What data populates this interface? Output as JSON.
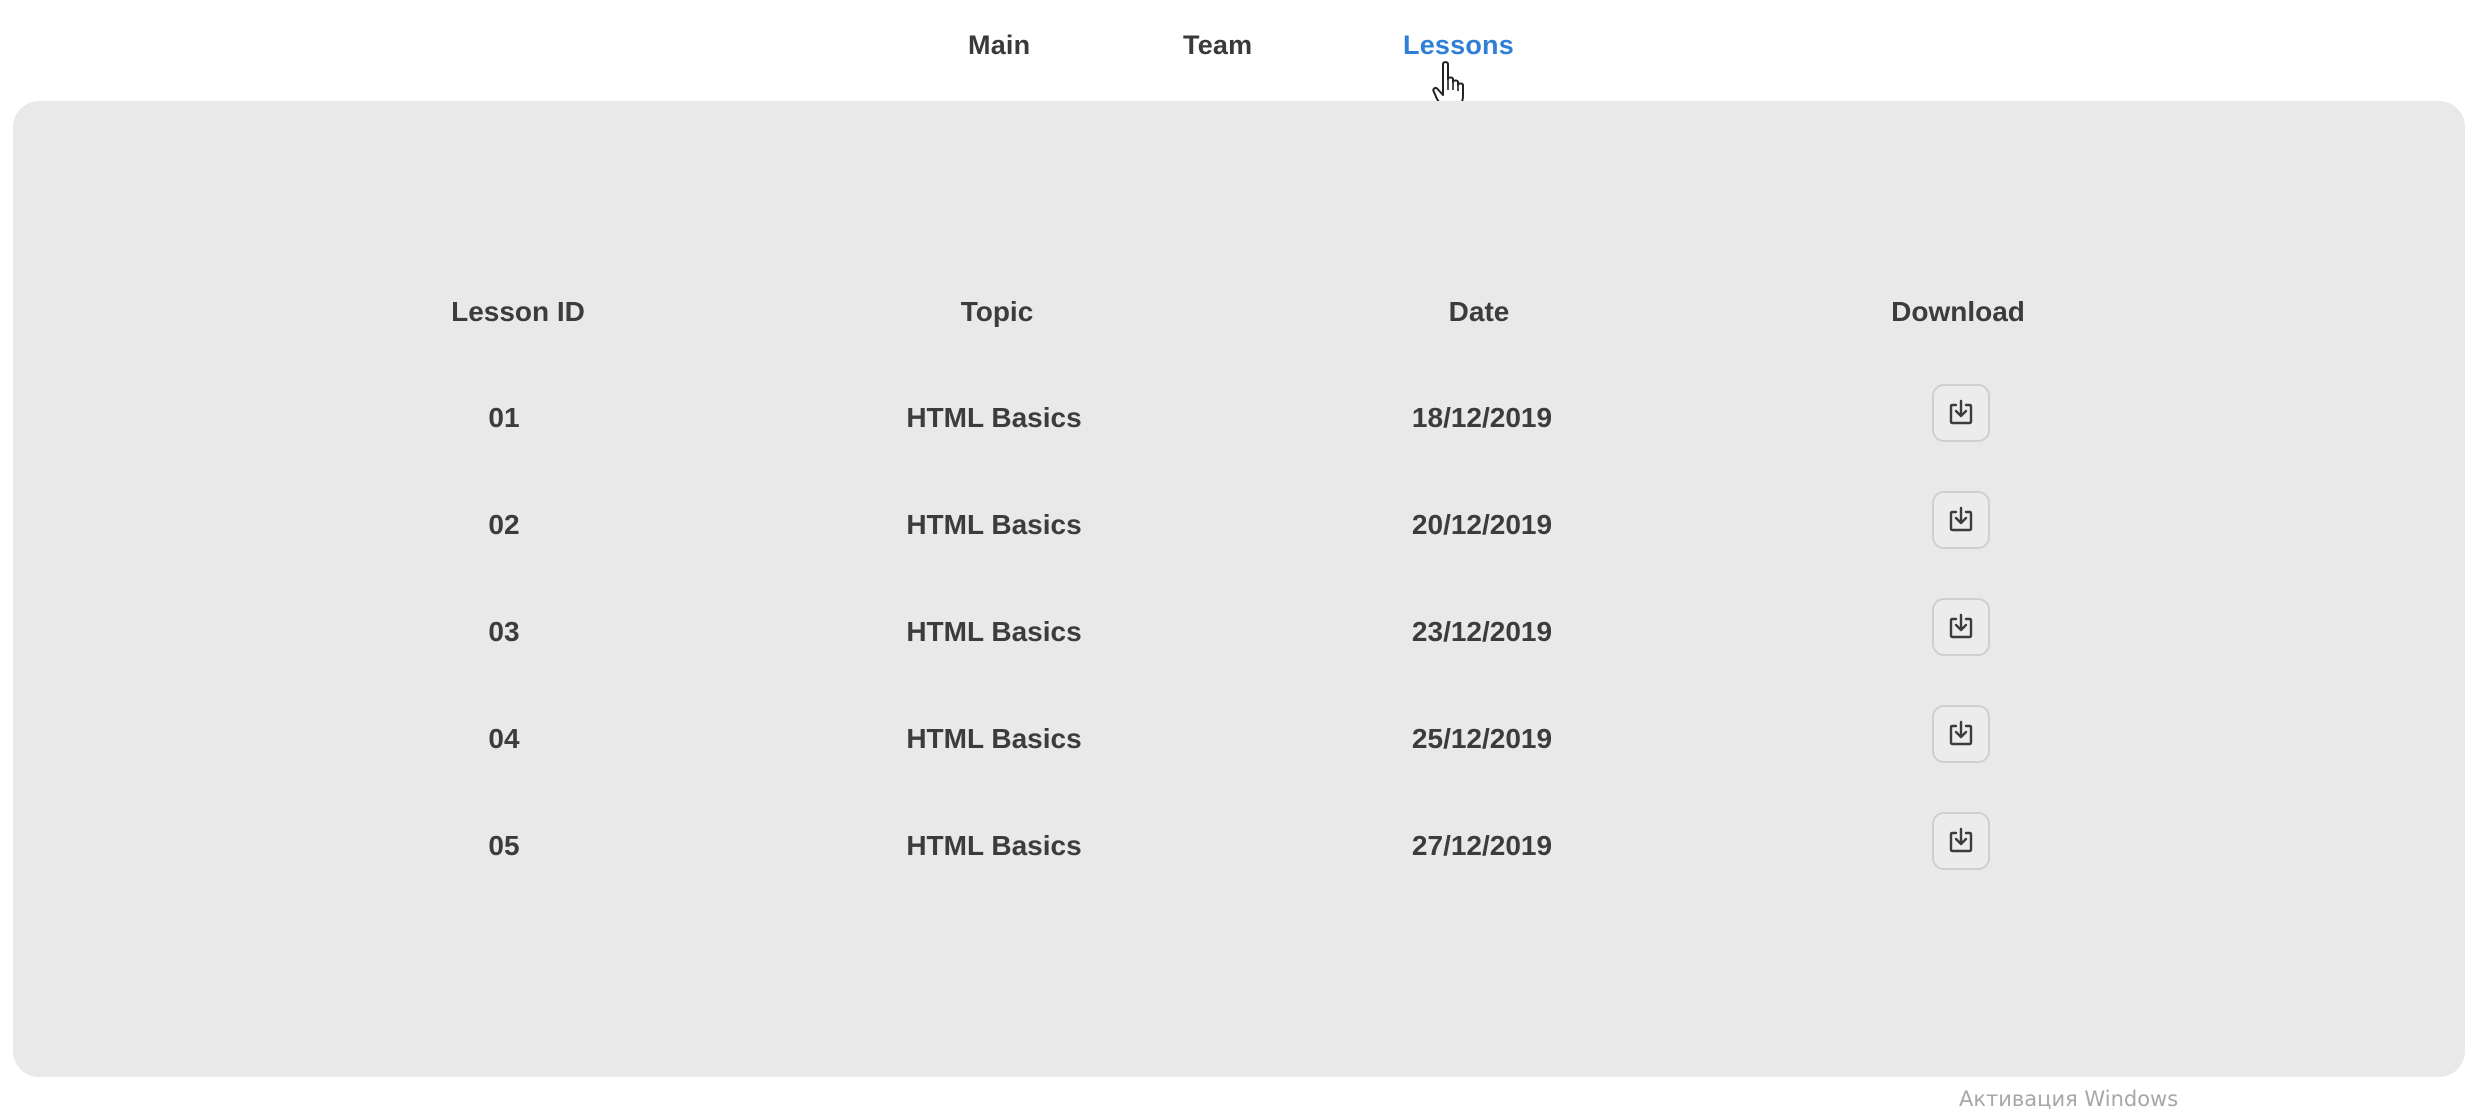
{
  "nav": {
    "items": [
      {
        "label": "Main",
        "active": false
      },
      {
        "label": "Team",
        "active": false
      },
      {
        "label": "Lessons",
        "active": true
      }
    ],
    "active_color": "#2f7fd7"
  },
  "table": {
    "columns": [
      "Lesson ID",
      "Topic",
      "Date",
      "Download"
    ],
    "rows": [
      {
        "id": "01",
        "topic": "HTML Basics",
        "date": "18/12/2019",
        "download_icon": "download-icon"
      },
      {
        "id": "02",
        "topic": "HTML Basics",
        "date": "20/12/2019",
        "download_icon": "download-icon"
      },
      {
        "id": "03",
        "topic": "HTML Basics",
        "date": "23/12/2019",
        "download_icon": "download-icon"
      },
      {
        "id": "04",
        "topic": "HTML Basics",
        "date": "25/12/2019",
        "download_icon": "download-icon"
      },
      {
        "id": "05",
        "topic": "HTML Basics",
        "date": "27/12/2019",
        "download_icon": "download-icon"
      }
    ]
  },
  "colors": {
    "panel_background": "#e9e9e9",
    "text": "#3c3c3c"
  },
  "os_watermark": "Активация Windows"
}
